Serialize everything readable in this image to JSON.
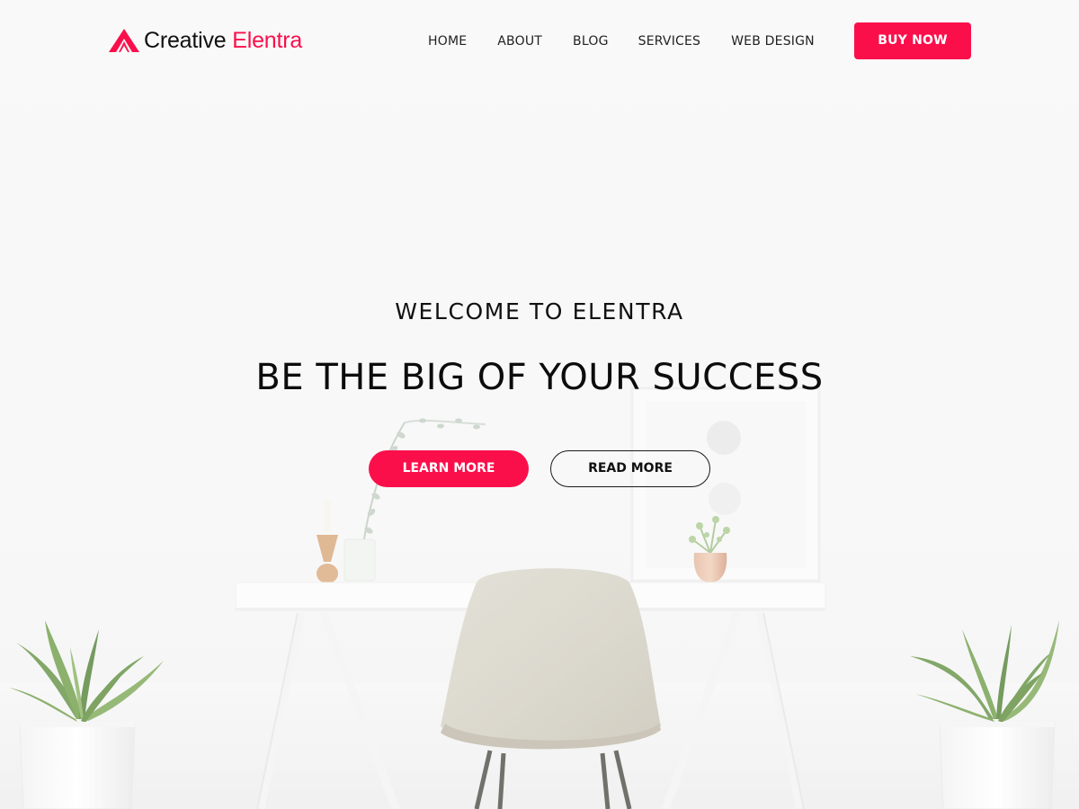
{
  "brand": {
    "name_primary": "Creative",
    "name_accent": "Elentra",
    "logo_icon": "triangle-logo-icon",
    "accent_color": "#fb0f4b"
  },
  "nav": {
    "items": [
      {
        "label": "HOME"
      },
      {
        "label": "ABOUT"
      },
      {
        "label": "BLOG"
      },
      {
        "label": "SERVICES"
      },
      {
        "label": "WEB DESIGN"
      }
    ],
    "cta_label": "BUY NOW"
  },
  "hero": {
    "subtitle": "WELCOME TO ELENTRA",
    "title": "BE THE BIG OF YOUR SUCCESS",
    "primary_button": "LEARN MORE",
    "secondary_button": "READ MORE"
  }
}
